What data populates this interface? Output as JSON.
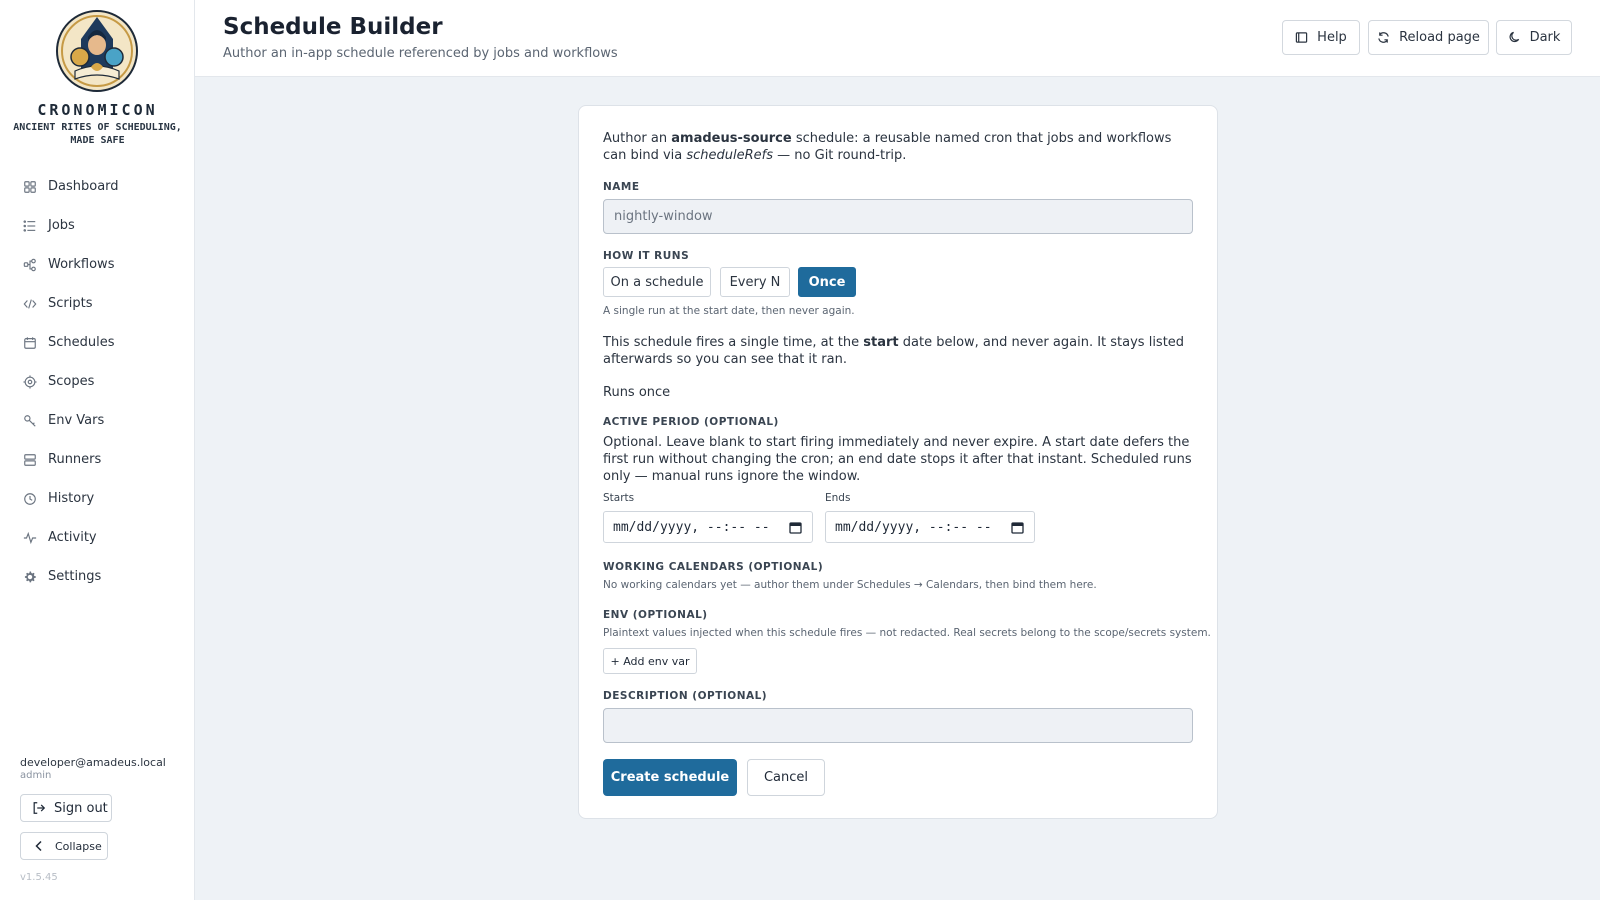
{
  "brand": {
    "name": "CRONOMICON",
    "tagline": "ANCIENT RITES OF SCHEDULING, MADE SAFE"
  },
  "sidebar": {
    "items": [
      {
        "label": "Dashboard",
        "icon": "grid-icon"
      },
      {
        "label": "Jobs",
        "icon": "list-icon"
      },
      {
        "label": "Workflows",
        "icon": "workflow-icon"
      },
      {
        "label": "Scripts",
        "icon": "code-icon"
      },
      {
        "label": "Schedules",
        "icon": "calendar-icon"
      },
      {
        "label": "Scopes",
        "icon": "target-icon"
      },
      {
        "label": "Env Vars",
        "icon": "key-icon"
      },
      {
        "label": "Runners",
        "icon": "server-icon"
      },
      {
        "label": "History",
        "icon": "clock-icon"
      },
      {
        "label": "Activity",
        "icon": "activity-icon"
      },
      {
        "label": "Settings",
        "icon": "gear-icon"
      }
    ],
    "user_email": "developer@amadeus.local",
    "user_role": "admin",
    "sign_out": "Sign out",
    "collapse": "Collapse",
    "version": "v1.5.45"
  },
  "header": {
    "title": "Schedule Builder",
    "subtitle": "Author an in-app schedule referenced by jobs and workflows",
    "help": "Help",
    "reload": "Reload page",
    "theme": "Dark"
  },
  "form": {
    "intro_prefix": "Author an ",
    "intro_bold": "amadeus-source",
    "intro_mid": " schedule: a reusable named cron that jobs and workflows can bind via ",
    "intro_italic": "scheduleRefs",
    "intro_suffix": " — no Git round-trip.",
    "name_label": "NAME",
    "name_placeholder": "nightly-window",
    "how_label": "HOW IT RUNS",
    "modes": [
      "On a schedule",
      "Every N",
      "Once"
    ],
    "selected_mode": "Once",
    "mode_hint": "A single run at the start date, then never again.",
    "once_prefix": "This schedule fires a single time, at the ",
    "once_bold": "start",
    "once_suffix": " date below, and never again. It stays listed afterwards so you can see that it ran.",
    "runs_summary": "Runs once",
    "active_label": "ACTIVE PERIOD (OPTIONAL)",
    "active_help": "Optional. Leave blank to start firing immediately and never expire. A start date defers the first run without changing the cron; an end date stops it after that instant. Scheduled runs only — manual runs ignore the window.",
    "starts_label": "Starts",
    "ends_label": "Ends",
    "date_placeholder": "mm/dd/yyyy, --:-- --",
    "calendars_label": "WORKING CALENDARS (OPTIONAL)",
    "calendars_help": "No working calendars yet — author them under Schedules → Calendars, then bind them here.",
    "env_label": "ENV (OPTIONAL)",
    "env_help": "Plaintext values injected when this schedule fires — not redacted. Real secrets belong to the scope/secrets system.",
    "add_env": "+ Add env var",
    "description_label": "DESCRIPTION (OPTIONAL)",
    "create": "Create schedule",
    "cancel": "Cancel"
  },
  "colors": {
    "accent": "#1f6b9c",
    "background": "#eef2f6",
    "sidebar_bg": "#ffffff"
  }
}
